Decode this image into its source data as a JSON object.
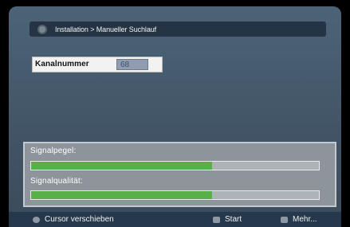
{
  "breadcrumb": {
    "text": "Installation > Manueller Suchlauf",
    "icon": "menu-icon"
  },
  "channel": {
    "label": "Kanalnummer",
    "value": "68"
  },
  "signal": {
    "level_label": "Signalpegel:",
    "level_fraction": 0.63,
    "quality_label": "Signalqualität:",
    "quality_fraction": 0.63,
    "bar_color": "#59b049"
  },
  "footer": {
    "move_cursor": {
      "label": "Cursor verschieben",
      "icon": "navigation-icon"
    },
    "start": {
      "label": "Start",
      "icon": "ok-icon"
    },
    "more": {
      "label": "Mehr...",
      "icon": "info-icon"
    }
  }
}
